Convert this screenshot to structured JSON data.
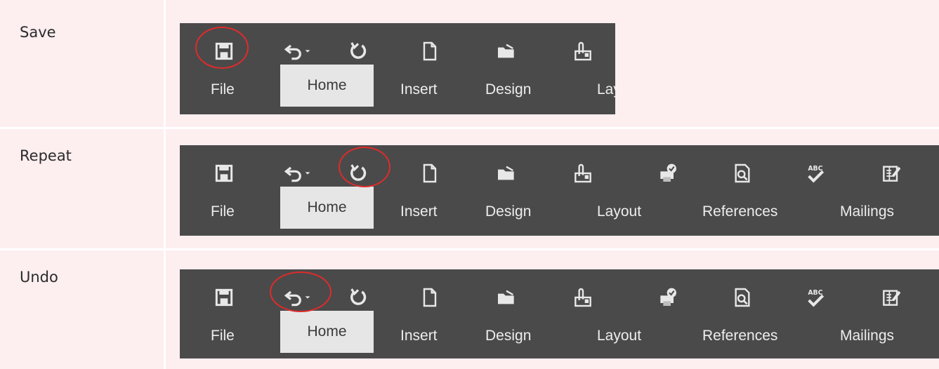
{
  "rows": [
    {
      "label": "Save",
      "tabs": [
        "File",
        "Home",
        "Insert",
        "Design",
        "Layout"
      ],
      "highlight": "save-icon"
    },
    {
      "label": "Repeat",
      "tabs": [
        "File",
        "Home",
        "Insert",
        "Design",
        "Layout",
        "References",
        "Mailings"
      ],
      "highlight": "repeat-icon"
    },
    {
      "label": "Undo",
      "tabs": [
        "File",
        "Home",
        "Insert",
        "Design",
        "Layout",
        "References",
        "Mailings"
      ],
      "highlight": "undo-icon"
    }
  ],
  "colors": {
    "background": "#fdeef0",
    "ribbon": "#4a4a4a",
    "highlight_circle": "#e02b2b",
    "active_tab": "#e6e6e6"
  },
  "icons": [
    "save-icon",
    "undo-icon",
    "undo-dropdown-icon",
    "repeat-icon",
    "new-document-icon",
    "open-folder-icon",
    "attach-icon",
    "print-preview-icon",
    "find-icon",
    "spelling-icon",
    "edit-icon"
  ]
}
